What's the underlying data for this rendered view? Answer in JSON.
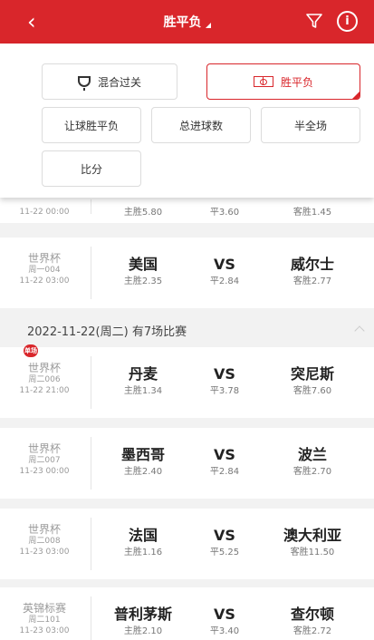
{
  "header": {
    "title": "胜平负",
    "back_icon": "‹",
    "info_icon": "i"
  },
  "panel": {
    "mixed_label": "混合过关",
    "wdl_label": "胜平负",
    "handicap_label": "让球胜平负",
    "total_goals_label": "总进球数",
    "half_full_label": "半全场",
    "score_label": "比分"
  },
  "partial_row": {
    "home_odd": "主胜5.80",
    "draw_odd": "平3.60",
    "away_odd": "客胜1.45",
    "time": "11-22 00:00"
  },
  "match_004": {
    "league": "世界杯",
    "no": "周一004",
    "time": "11-22 03:00",
    "home": "美国",
    "vs": "VS",
    "away": "威尔士",
    "home_odd": "主胜2.35",
    "draw_odd": "平2.84",
    "away_odd": "客胜2.77"
  },
  "date_header": {
    "text": "2022-11-22(周二) 有7场比赛"
  },
  "hot_badge": "单场",
  "matches": [
    {
      "league": "世界杯",
      "no": "周二006",
      "time": "11-22 21:00",
      "home": "丹麦",
      "vs": "VS",
      "away": "突尼斯",
      "home_odd": "主胜1.34",
      "draw_odd": "平3.78",
      "away_odd": "客胜7.60"
    },
    {
      "league": "世界杯",
      "no": "周二007",
      "time": "11-23 00:00",
      "home": "墨西哥",
      "vs": "VS",
      "away": "波兰",
      "home_odd": "主胜2.40",
      "draw_odd": "平2.84",
      "away_odd": "客胜2.70"
    },
    {
      "league": "世界杯",
      "no": "周二008",
      "time": "11-23 03:00",
      "home": "法国",
      "vs": "VS",
      "away": "澳大利亚",
      "home_odd": "主胜1.16",
      "draw_odd": "平5.25",
      "away_odd": "客胜11.50"
    },
    {
      "league": "英锦标赛",
      "no": "周二101",
      "time": "11-23 03:00",
      "home": "普利茅斯",
      "vs": "VS",
      "away": "查尔顿",
      "home_odd": "主胜2.10",
      "draw_odd": "平3.40",
      "away_odd": "客胜2.72"
    }
  ],
  "colors": {
    "brand": "#d9262b",
    "bg": "#f2f2f2"
  }
}
